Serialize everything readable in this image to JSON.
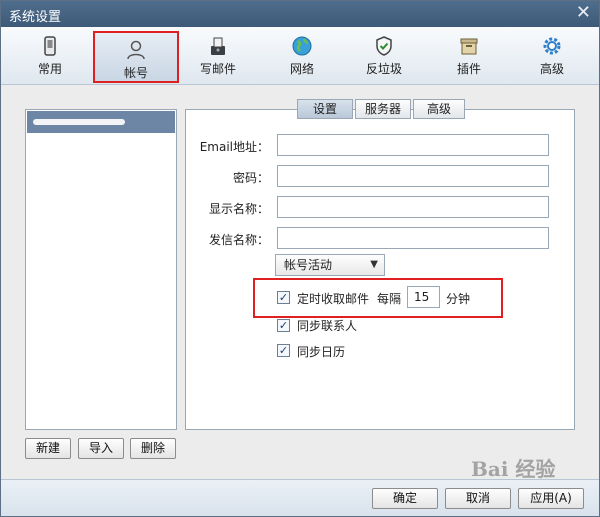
{
  "window": {
    "title": "系统设置",
    "close_glyph": "✕"
  },
  "toolbar": {
    "items": [
      {
        "label": "常用",
        "icon": "phone-icon"
      },
      {
        "label": "帐号",
        "icon": "user-icon",
        "selected": true
      },
      {
        "label": "写邮件",
        "icon": "compose-icon"
      },
      {
        "label": "网络",
        "icon": "globe-icon"
      },
      {
        "label": "反垃圾",
        "icon": "shield-icon"
      },
      {
        "label": "插件",
        "icon": "box-icon"
      },
      {
        "label": "高级",
        "icon": "gear-icon"
      }
    ]
  },
  "accounts": {
    "buttons": {
      "new": "新建",
      "import": "导入",
      "delete": "删除"
    }
  },
  "tabs": [
    {
      "label": "设置",
      "active": true
    },
    {
      "label": "服务器"
    },
    {
      "label": "高级"
    }
  ],
  "form": {
    "email_label": "Email地址：",
    "password_label": "密码：",
    "display_name_label": "显示名称：",
    "sender_name_label": "发信名称：",
    "status_select": "帐号活动",
    "auto_receive_label": "定时收取邮件",
    "every_label": "每隔",
    "interval_value": "15",
    "minutes_label": "分钟",
    "sync_contacts_label": "同步联系人",
    "sync_calendar_label": "同步日历"
  },
  "footer": {
    "ok": "确定",
    "cancel": "取消",
    "apply": "应用(A)"
  },
  "colors": {
    "highlight": "#e02020",
    "titlebar": "#4f6d8c"
  },
  "watermark": "Bai 经验"
}
